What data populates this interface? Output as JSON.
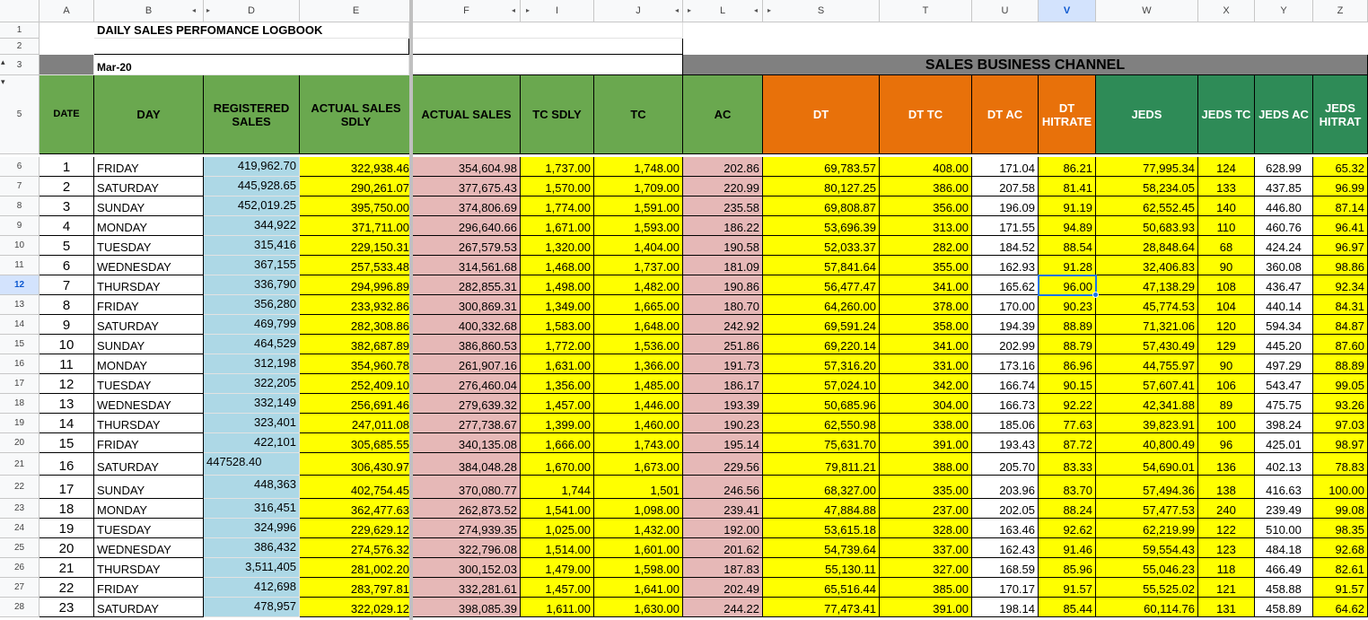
{
  "sheet": {
    "title": "DAILY SALES PERFOMANCE LOGBOOK",
    "period": "Mar-20",
    "channel_title": "SALES BUSINESS CHANNEL"
  },
  "column_letters": [
    "A",
    "B",
    "D",
    "E",
    "F",
    "I",
    "J",
    "L",
    "S",
    "T",
    "U",
    "V",
    "W",
    "X",
    "Y",
    "Z"
  ],
  "row_numbers": [
    "1",
    "2",
    "3",
    "5",
    "6",
    "7",
    "8",
    "9",
    "10",
    "11",
    "12",
    "13",
    "14",
    "15",
    "16",
    "17",
    "18",
    "19",
    "20",
    "21",
    "22",
    "23",
    "24",
    "25",
    "26",
    "27",
    "28"
  ],
  "headers": [
    "DATE",
    "DAY",
    "REGISTERED SALES",
    "ACTUAL SALES SDLY",
    "ACTUAL SALES",
    "TC SDLY",
    "TC",
    "AC",
    "DT",
    "DT TC",
    "DT AC",
    "DT HITRATE",
    "JEDS",
    "JEDS TC",
    "JEDS AC",
    "JEDS HITRAT"
  ],
  "rows": [
    [
      "1",
      "FRIDAY",
      "419,962.70",
      "322,938.46",
      "354,604.98",
      "1,737.00",
      "1,748.00",
      "202.86",
      "69,783.57",
      "408.00",
      "171.04",
      "86.21",
      "77,995.34",
      "124",
      "628.99",
      "65.32"
    ],
    [
      "2",
      "SATURDAY",
      "445,928.65",
      "290,261.07",
      "377,675.43",
      "1,570.00",
      "1,709.00",
      "220.99",
      "80,127.25",
      "386.00",
      "207.58",
      "81.41",
      "58,234.05",
      "133",
      "437.85",
      "96.99"
    ],
    [
      "3",
      "SUNDAY",
      "452,019.25",
      "395,750.00",
      "374,806.69",
      "1,774.00",
      "1,591.00",
      "235.58",
      "69,808.87",
      "356.00",
      "196.09",
      "91.19",
      "62,552.45",
      "140",
      "446.80",
      "87.14"
    ],
    [
      "4",
      "MONDAY",
      "344,922",
      "371,711.00",
      "296,640.66",
      "1,671.00",
      "1,593.00",
      "186.22",
      "53,696.39",
      "313.00",
      "171.55",
      "94.89",
      "50,683.93",
      "110",
      "460.76",
      "96.41"
    ],
    [
      "5",
      "TUESDAY",
      "315,416",
      "229,150.31",
      "267,579.53",
      "1,320.00",
      "1,404.00",
      "190.58",
      "52,033.37",
      "282.00",
      "184.52",
      "88.54",
      "28,848.64",
      "68",
      "424.24",
      "96.97"
    ],
    [
      "6",
      "WEDNESDAY",
      "367,155",
      "257,533.48",
      "314,561.68",
      "1,468.00",
      "1,737.00",
      "181.09",
      "57,841.64",
      "355.00",
      "162.93",
      "91.28",
      "32,406.83",
      "90",
      "360.08",
      "98.86"
    ],
    [
      "7",
      "THURSDAY",
      "336,790",
      "294,996.89",
      "282,855.31",
      "1,498.00",
      "1,482.00",
      "190.86",
      "56,477.47",
      "341.00",
      "165.62",
      "96.00",
      "47,138.29",
      "108",
      "436.47",
      "92.34"
    ],
    [
      "8",
      "FRIDAY",
      "356,280",
      "233,932.86",
      "300,869.31",
      "1,349.00",
      "1,665.00",
      "180.70",
      "64,260.00",
      "378.00",
      "170.00",
      "90.23",
      "45,774.53",
      "104",
      "440.14",
      "84.31"
    ],
    [
      "9",
      "SATURDAY",
      "469,799",
      "282,308.86",
      "400,332.68",
      "1,583.00",
      "1,648.00",
      "242.92",
      "69,591.24",
      "358.00",
      "194.39",
      "88.89",
      "71,321.06",
      "120",
      "594.34",
      "84.87"
    ],
    [
      "10",
      "SUNDAY",
      "464,529",
      "382,687.89",
      "386,860.53",
      "1,772.00",
      "1,536.00",
      "251.86",
      "69,220.14",
      "341.00",
      "202.99",
      "88.79",
      "57,430.49",
      "129",
      "445.20",
      "87.60"
    ],
    [
      "11",
      "MONDAY",
      "312,198",
      "354,960.78",
      "261,907.16",
      "1,631.00",
      "1,366.00",
      "191.73",
      "57,316.20",
      "331.00",
      "173.16",
      "86.96",
      "44,755.97",
      "90",
      "497.29",
      "88.89"
    ],
    [
      "12",
      "TUESDAY",
      "322,205",
      "252,409.10",
      "276,460.04",
      "1,356.00",
      "1,485.00",
      "186.17",
      "57,024.10",
      "342.00",
      "166.74",
      "90.15",
      "57,607.41",
      "106",
      "543.47",
      "99.05"
    ],
    [
      "13",
      "WEDNESDAY",
      "332,149",
      "256,691.46",
      "279,639.32",
      "1,457.00",
      "1,446.00",
      "193.39",
      "50,685.96",
      "304.00",
      "166.73",
      "92.22",
      "42,341.88",
      "89",
      "475.75",
      "93.26"
    ],
    [
      "14",
      "THURSDAY",
      "323,401",
      "247,011.08",
      "277,738.67",
      "1,399.00",
      "1,460.00",
      "190.23",
      "62,550.98",
      "338.00",
      "185.06",
      "77.63",
      "39,823.91",
      "100",
      "398.24",
      "97.03"
    ],
    [
      "15",
      "FRIDAY",
      "422,101",
      "305,685.55",
      "340,135.08",
      "1,666.00",
      "1,743.00",
      "195.14",
      "75,631.70",
      "391.00",
      "193.43",
      "87.72",
      "40,800.49",
      "96",
      "425.01",
      "98.97"
    ],
    [
      "16",
      "SATURDAY",
      "447528.40",
      "306,430.97",
      "384,048.28",
      "1,670.00",
      "1,673.00",
      "229.56",
      "79,811.21",
      "388.00",
      "205.70",
      "83.33",
      "54,690.01",
      "136",
      "402.13",
      "78.83"
    ],
    [
      "17",
      "SUNDAY",
      "448,363",
      "402,754.45",
      "370,080.77",
      "1,744",
      "1,501",
      "246.56",
      "68,327.00",
      "335.00",
      "203.96",
      "83.70",
      "57,494.36",
      "138",
      "416.63",
      "100.00"
    ],
    [
      "18",
      "MONDAY",
      "316,451",
      "362,477.63",
      "262,873.52",
      "1,541.00",
      "1,098.00",
      "239.41",
      "47,884.88",
      "237.00",
      "202.05",
      "88.24",
      "57,477.53",
      "240",
      "239.49",
      "99.08"
    ],
    [
      "19",
      "TUESDAY",
      "324,996",
      "229,629.12",
      "274,939.35",
      "1,025.00",
      "1,432.00",
      "192.00",
      "53,615.18",
      "328.00",
      "163.46",
      "92.62",
      "62,219.99",
      "122",
      "510.00",
      "98.35"
    ],
    [
      "20",
      "WEDNESDAY",
      "386,432",
      "274,576.32",
      "322,796.08",
      "1,514.00",
      "1,601.00",
      "201.62",
      "54,739.64",
      "337.00",
      "162.43",
      "91.46",
      "59,554.43",
      "123",
      "484.18",
      "92.68"
    ],
    [
      "21",
      "THURSDAY",
      "3,511,405",
      "281,002.20",
      "300,152.03",
      "1,479.00",
      "1,598.00",
      "187.83",
      "55,130.11",
      "327.00",
      "168.59",
      "85.96",
      "55,046.23",
      "118",
      "466.49",
      "82.61"
    ],
    [
      "22",
      "FRIDAY",
      "412,698",
      "283,797.81",
      "332,281.61",
      "1,457.00",
      "1,641.00",
      "202.49",
      "65,516.44",
      "385.00",
      "170.17",
      "91.57",
      "55,525.02",
      "121",
      "458.88",
      "91.57"
    ],
    [
      "23",
      "SATURDAY",
      "478,957",
      "322,029.12",
      "398,085.39",
      "1,611.00",
      "1,630.00",
      "244.22",
      "77,473.41",
      "391.00",
      "198.14",
      "85.44",
      "60,114.76",
      "131",
      "458.89",
      "64.62"
    ]
  ],
  "colors": {
    "header_green": "#6aa84f",
    "registered_blue": "#add8e6",
    "highlight_yellow": "#ffff00",
    "actual_pink": "#e6b8b7",
    "dt_orange": "#e8710a",
    "jeds_teal": "#2e8b57",
    "channel_gray": "#808080",
    "selection_blue": "#1a73e8"
  },
  "selected_cell": {
    "column": "V",
    "row": "12"
  }
}
